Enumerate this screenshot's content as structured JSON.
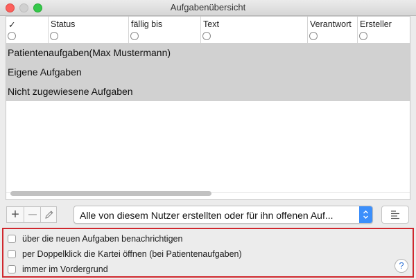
{
  "window": {
    "title": "Aufgabenübersicht"
  },
  "table": {
    "columns": [
      {
        "label": "✓"
      },
      {
        "label": "Status"
      },
      {
        "label": "fällig bis"
      },
      {
        "label": "Text"
      },
      {
        "label": "Verantwort"
      },
      {
        "label": "Ersteller"
      }
    ],
    "groups": [
      "Patientenaufgaben(Max Mustermann)",
      "Eigene Aufgaben",
      "Nicht zugewiesene Aufgaben"
    ]
  },
  "toolbar": {
    "add_symbol": "+",
    "filter_value": "Alle von diesem Nutzer erstellten oder für ihn offenen Auf...",
    "accent_color": "#3c8ffb"
  },
  "options": [
    {
      "label": "über die neuen Aufgaben benachrichtigen",
      "checked": false
    },
    {
      "label": "per Doppelklick die Kartei öffnen (bei Patientenaufgaben)",
      "checked": false
    },
    {
      "label": "immer im Vordergrund",
      "checked": false
    }
  ],
  "help": {
    "symbol": "?"
  },
  "icons": [
    "close-icon",
    "minimize-icon",
    "zoom-icon",
    "plus-icon",
    "minus-icon",
    "pencil-icon",
    "up-down-arrows-icon",
    "align-lines-icon",
    "help-icon"
  ],
  "colors": {
    "highlight_border": "#d0282e",
    "group_row": "#d1d1d1"
  }
}
